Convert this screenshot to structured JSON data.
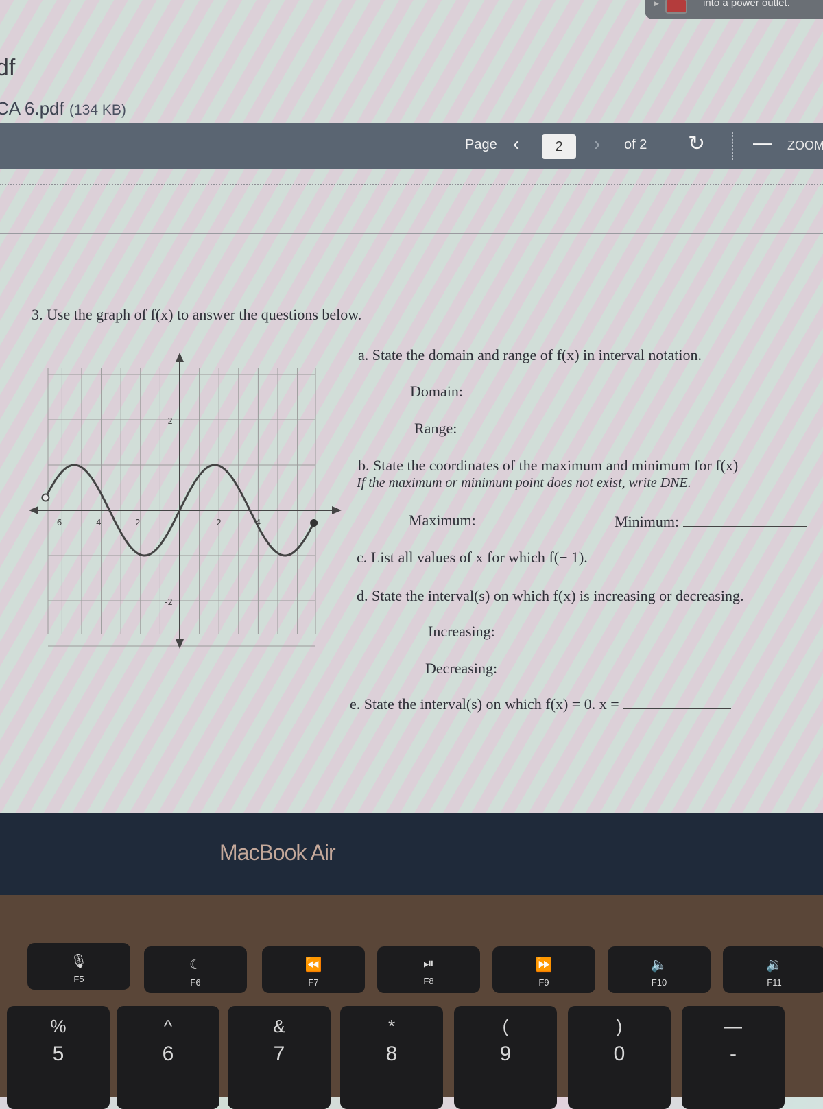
{
  "notification": {
    "message": "into a power outlet."
  },
  "document": {
    "title": "df",
    "file_name": "CA 6.pdf",
    "file_size": "(134 KB)"
  },
  "toolbar": {
    "page_label": "Page",
    "prev_icon": "chevron-left",
    "current_page": "2",
    "next_icon": "chevron-right",
    "of_label": "of 2",
    "rotate_icon": "rotate",
    "zoom_out_icon": "minus",
    "zoom_label": "ZOOM"
  },
  "problem": {
    "heading": "3. Use the graph of f(x) to answer the questions below.",
    "a": {
      "text": "a.  State the domain and range of f(x) in interval notation.",
      "domain_label": "Domain:",
      "range_label": "Range:"
    },
    "b": {
      "text": "b. State the coordinates of the maximum and minimum for f(x)",
      "note": "If the maximum or minimum point does not exist, write DNE.",
      "max_label": "Maximum:",
      "min_label": "Minimum:"
    },
    "c": {
      "text": "c. List all values of x for which f(− 1)."
    },
    "d": {
      "text": "d. State the interval(s) on which f(x) is increasing or decreasing.",
      "inc_label": "Increasing:",
      "dec_label": "Decreasing:"
    },
    "e": {
      "text": "e. State the interval(s) on which f(x) = 0. x ="
    }
  },
  "chart_data": {
    "type": "line",
    "title": "",
    "xlabel": "",
    "ylabel": "",
    "function": "sin(x)",
    "xlim": [
      -7,
      7
    ],
    "ylim": [
      -3,
      3
    ],
    "grid": true,
    "x_ticks": [
      {
        "v": -6,
        "label": "-6"
      },
      {
        "v": -4,
        "label": "-4"
      },
      {
        "v": -2,
        "label": "-2"
      },
      {
        "v": 2,
        "label": "2"
      },
      {
        "v": 4,
        "label": "4"
      }
    ],
    "y_ticks": [
      {
        "v": 2,
        "label": "2"
      },
      {
        "v": -2,
        "label": "-2"
      }
    ],
    "domain": [
      -6,
      6
    ],
    "start_point": {
      "x": -6,
      "y": 0.28,
      "open": true
    },
    "end_point": {
      "x": 6,
      "y": -0.28,
      "open": false
    },
    "maxima": [
      {
        "x": -4.71,
        "y": 1
      },
      {
        "x": 1.57,
        "y": 1
      }
    ],
    "minima": [
      {
        "x": -1.57,
        "y": -1
      },
      {
        "x": 4.71,
        "y": -1
      }
    ],
    "zeros": [
      -3.14,
      0,
      3.14
    ]
  },
  "laptop": {
    "brand": "MacBook Air",
    "fkeys": [
      {
        "icon": "🎙",
        "label": "F5"
      },
      {
        "icon": "☾",
        "label": "F6"
      },
      {
        "icon": "⏪",
        "label": "F7"
      },
      {
        "icon": "⏯",
        "label": "F8"
      },
      {
        "icon": "⏩",
        "label": "F9"
      },
      {
        "icon": "🔈",
        "label": "F10"
      },
      {
        "icon": "🔉",
        "label": "F11"
      }
    ],
    "numkeys": [
      {
        "top": "%",
        "bot": "5"
      },
      {
        "top": "^",
        "bot": "6"
      },
      {
        "top": "&",
        "bot": "7"
      },
      {
        "top": "*",
        "bot": "8"
      },
      {
        "top": "(",
        "bot": "9"
      },
      {
        "top": ")",
        "bot": "0"
      },
      {
        "top": "—",
        "bot": "-"
      }
    ]
  }
}
